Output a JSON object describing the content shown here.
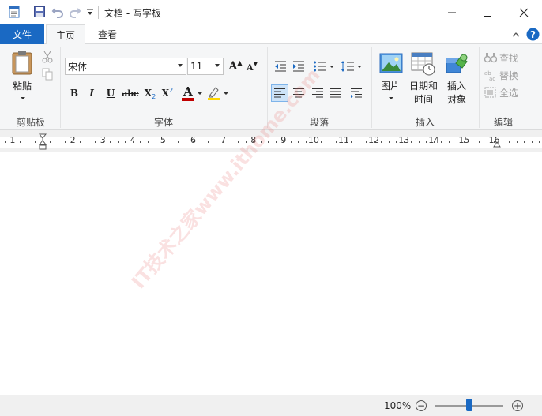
{
  "titlebar": {
    "title": "文档 - 写字板",
    "icons": [
      "wordpad-app-icon",
      "save-icon",
      "undo-icon",
      "redo-icon",
      "customize-toolbar-icon"
    ],
    "window_buttons": [
      "minimize-icon",
      "maximize-icon",
      "close-icon"
    ]
  },
  "tabs": {
    "file": "文件",
    "home": "主页",
    "view": "查看",
    "active": "主页"
  },
  "ribbon": {
    "clipboard": {
      "label": "剪贴板",
      "paste": "粘贴",
      "cut_icon": "scissors-icon",
      "copy_icon": "copy-icon"
    },
    "font": {
      "label": "字体",
      "family": "宋体",
      "size": "11",
      "grow_label": "A",
      "shrink_label": "A",
      "bold": "B",
      "italic": "I",
      "underline": "U",
      "strike": "abc",
      "subscript": "X",
      "superscript": "X",
      "sub_mark": "2",
      "sup_mark": "2",
      "color_label": "A",
      "text_color": "#c00000",
      "highlight_color": "#ffd700"
    },
    "paragraph": {
      "label": "段落"
    },
    "insert": {
      "label": "插入",
      "picture": "图片",
      "datetime_line1": "日期和",
      "datetime_line2": "时间",
      "object_line1": "插入",
      "object_line2": "对象"
    },
    "editing": {
      "label": "编辑",
      "find": "查找",
      "replace": "替换",
      "select_all": "全选"
    }
  },
  "ruler": {
    "numbers": [
      "1",
      "1",
      "2",
      "3",
      "4",
      "5",
      "6",
      "7",
      "8",
      "9",
      "10",
      "11",
      "12",
      "13",
      "14",
      "15",
      "16"
    ]
  },
  "document": {
    "watermark": "IT技术之家www.ithome.com"
  },
  "statusbar": {
    "zoom": "100%",
    "zoom_out": "−",
    "zoom_in": "+",
    "zoom_fraction": 0.5
  },
  "colors": {
    "accent": "#1a69c3",
    "ribbon_bg": "#f5f6f7",
    "status_bg": "#f0f0f0"
  }
}
